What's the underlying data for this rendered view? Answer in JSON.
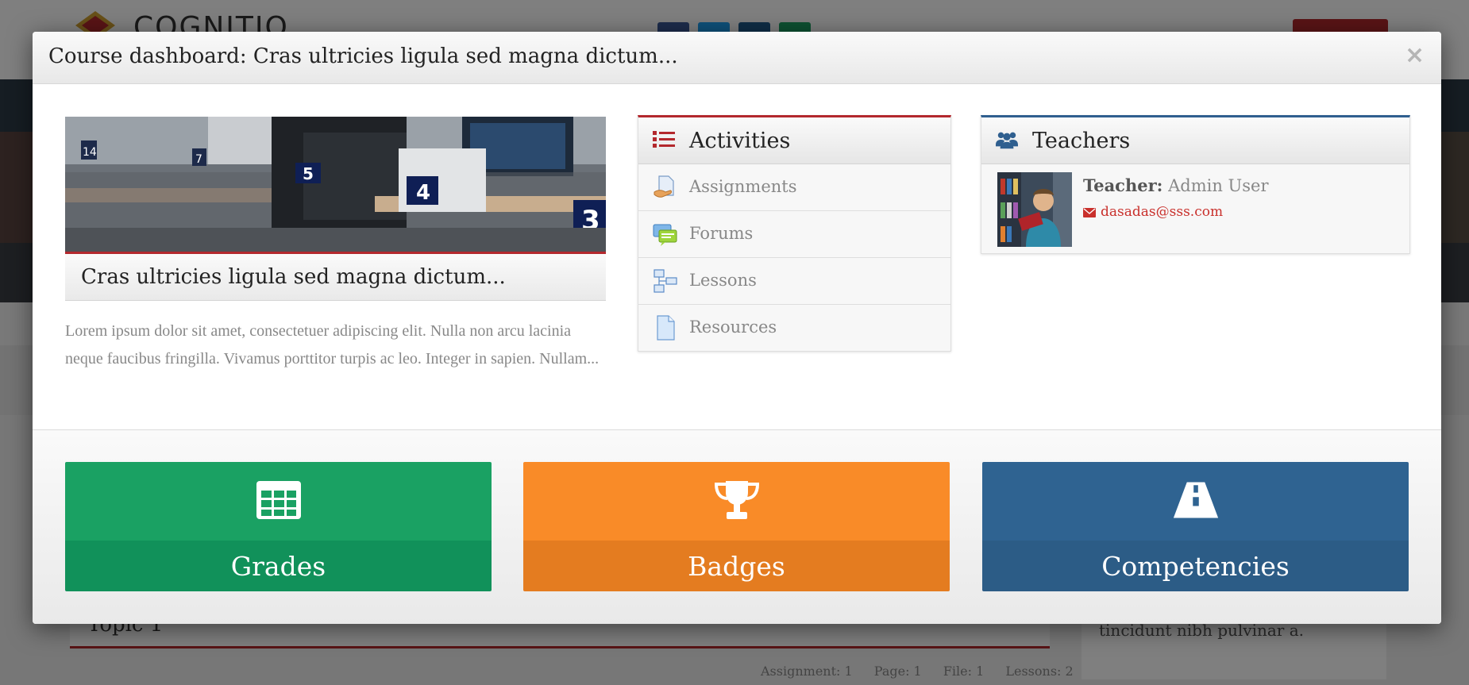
{
  "background": {
    "logo_text": "COGNITIO",
    "topic_title": "Topic 1",
    "side_text": "tincidunt nibh pulvinar a.",
    "stats": [
      "Assignment: 1",
      "Page: 1",
      "File: 1",
      "Lessons: 2"
    ]
  },
  "modal": {
    "title": "Course dashboard: Cras ultricies ligula sed magna dictum...",
    "close_label": "×"
  },
  "course": {
    "name": "Cras ultricies ligula sed magna dictum...",
    "description": "Lorem ipsum dolor sit amet, consectetuer adipiscing elit. Nulla non arcu lacinia neque faucibus fringilla. Vivamus porttitor turpis ac leo. Integer in sapien. Nullam..."
  },
  "activities": {
    "title": "Activities",
    "icon": "list-icon",
    "items": [
      {
        "label": "Assignments",
        "icon": "assignment-icon"
      },
      {
        "label": "Forums",
        "icon": "forum-icon"
      },
      {
        "label": "Lessons",
        "icon": "lesson-icon"
      },
      {
        "label": "Resources",
        "icon": "resource-icon"
      }
    ]
  },
  "teachers": {
    "title": "Teachers",
    "icon": "users-icon",
    "teacher_label": "Teacher:",
    "teacher_name": "Admin User",
    "email": "dasadas@sss.com"
  },
  "tiles": [
    {
      "label": "Grades",
      "icon": "table-icon",
      "color_top": "#1aa163",
      "color_bottom": "#11915a"
    },
    {
      "label": "Badges",
      "icon": "trophy-icon",
      "color_top": "#f98b28",
      "color_bottom": "#e47c20"
    },
    {
      "label": "Competencies",
      "icon": "road-icon",
      "color_top": "#2f6391",
      "color_bottom": "#2c5c86"
    }
  ],
  "colors": {
    "accent_red": "#b3282d",
    "accent_blue": "#2f5f8f",
    "link_red": "#c9302c"
  }
}
